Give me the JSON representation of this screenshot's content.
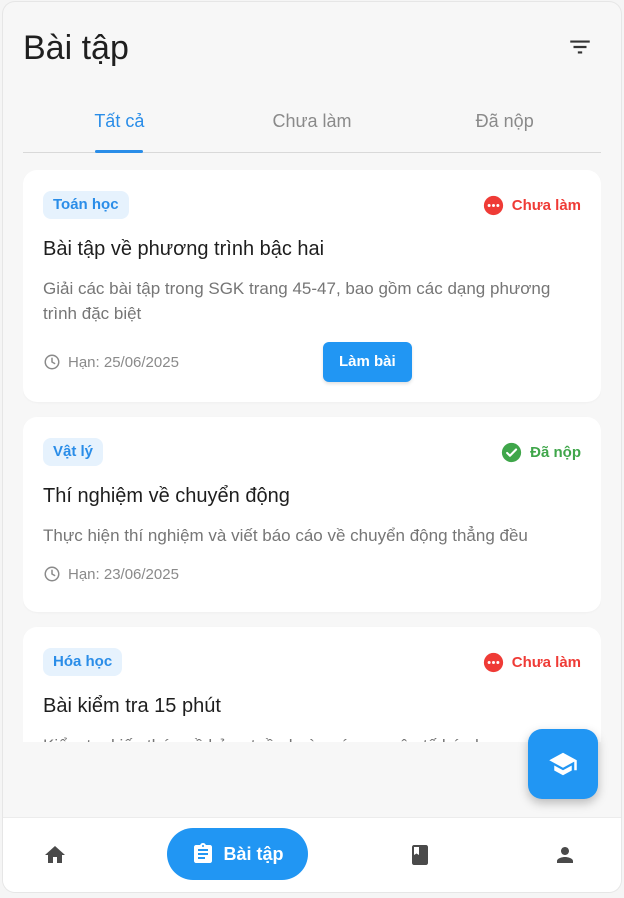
{
  "header": {
    "title": "Bài tập",
    "filter_icon": "filter-icon"
  },
  "tabs": [
    {
      "label": "Tất cả",
      "active": true
    },
    {
      "label": "Chưa làm",
      "active": false
    },
    {
      "label": "Đã nộp",
      "active": false
    }
  ],
  "assignments": [
    {
      "subject": "Toán học",
      "status": "Chưa làm",
      "status_type": "todo",
      "title": "Bài tập về phương trình bậc hai",
      "description": "Giải các bài tập trong SGK trang 45-47, bao gồm các dạng phương trình đặc biệt",
      "deadline": "Hạn: 25/06/2025",
      "action_label": "Làm bài"
    },
    {
      "subject": "Vật lý",
      "status": "Đã nộp",
      "status_type": "done",
      "title": "Thí nghiệm về chuyển động",
      "description": "Thực hiện thí nghiệm và viết báo cáo về chuyển động thẳng đều",
      "deadline": "Hạn: 23/06/2025"
    },
    {
      "subject": "Hóa học",
      "status": "Chưa làm",
      "status_type": "todo",
      "title": "Bài kiểm tra 15 phút",
      "description": "Kiểm tra kiến thức về bảng tuần hoàn các nguyên tố hóa học"
    }
  ],
  "fab": {
    "icon": "graduation-cap-icon"
  },
  "bottom_nav": {
    "items": [
      {
        "icon": "home-icon"
      },
      {
        "icon": "assignment-icon",
        "label": "Bài tập",
        "active": true
      },
      {
        "icon": "book-icon"
      },
      {
        "icon": "person-icon"
      }
    ]
  },
  "colors": {
    "primary": "#2196f3",
    "todo": "#ef3b36",
    "done": "#3fa64a"
  }
}
